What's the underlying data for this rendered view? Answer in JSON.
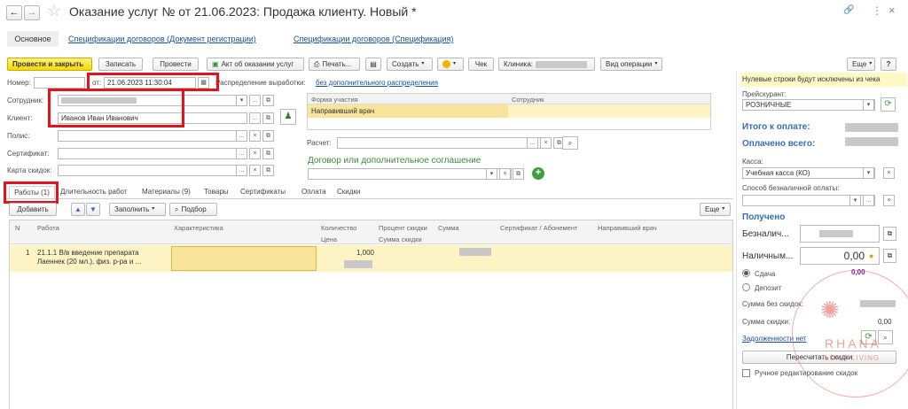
{
  "window": {
    "title": "Оказание услуг №  от 21.06.2023: Продажа клиенту. Новый *",
    "nav_back": "←",
    "nav_forward": "→",
    "star": "☆",
    "link_icon": "🔗",
    "menu_icon": "⋮",
    "close_icon": "×"
  },
  "view_tabs": {
    "main": "Основное",
    "spec_doc": "Спецификации договоров (Документ регистрации)",
    "spec": "Спецификации договоров (Спецификация)"
  },
  "toolbar": {
    "post_close": "Провести и закрыть",
    "save": "Записать",
    "post": "Провести",
    "act": "Акт об оказании услуг",
    "print": "Печать...",
    "create": "Создать",
    "check": "Чек",
    "clinic": "Клиника:",
    "op_type": "Вид операции",
    "more": "Еще",
    "help": "?"
  },
  "form": {
    "number_label": "Номер:",
    "number_value": "",
    "date_prefix": "от:",
    "date_value": "21.06.2023 11:30:04",
    "distribution_label": "Распределение выработки:",
    "distribution_link": "без дополнительного распределения",
    "employee_label": "Сотрудник:",
    "client_label": "Клиент:",
    "client_value": "Иванов Иван Иванович",
    "policy_label": "Полис:",
    "certificate_label": "Сертификат:",
    "discount_card_label": "Карта скидок:",
    "payment_label": "Расчет:",
    "contract_label": "Договор или дополнительное соглашение"
  },
  "participation": {
    "headers": [
      "Форма участия",
      "Сотрудник"
    ],
    "rows": [
      [
        "Направивший врач",
        ""
      ]
    ]
  },
  "doc_tabs": [
    "Работы (1)",
    "Длительность работ",
    "Материалы (9)",
    "Товары",
    "Сертификаты",
    "Оплата",
    "Скидки"
  ],
  "grid_toolbar": {
    "add": "Добавить",
    "fill": "Заполнить",
    "select": "Подбор",
    "more": "Еще"
  },
  "grid": {
    "headers": {
      "n": "N",
      "work": "Работа",
      "characteristic": "Характеристика",
      "quantity": "Количество",
      "price": "Цена",
      "discount_pct": "Процент скидки",
      "discount_sum": "Сумма скидки",
      "sum": "Сумма",
      "certificate": "Сертификат / Абонемент",
      "referring_doctor": "Направивший врач"
    },
    "rows": [
      {
        "n": "1",
        "work_line1": "21.1.1 В/в введение препарата",
        "work_line2": "Лаеннек (20 мл.), физ. р-ра  и ...",
        "quantity": "1,000"
      }
    ]
  },
  "right_panel": {
    "notice": "Нулевые строки будут исключены из чека",
    "price_list_label": "Прейскурант:",
    "price_list_value": "РОЗНИЧНЫЕ",
    "total_label": "Итого к оплате:",
    "paid_label": "Оплачено всего:",
    "cash_register_label": "Касса:",
    "cash_register_value": "Учебная касса (КО)",
    "cashless_method_label": "Способ безналичной оплаты:",
    "received_title": "Получено",
    "cashless_label": "Безналич...",
    "cash_label": "Наличным...",
    "cash_value": "0,00",
    "change_label": "Сдача",
    "change_value": "0,00",
    "deposit_label": "Депозит",
    "sum_wo_discount_label": "Сумма без скидок:",
    "discount_sum_label": "Сумма скидки:",
    "discount_sum_value": "0,00",
    "debts_link": "Задолженности нет",
    "recalc_button": "Пересчитать скидки",
    "manual_discount_label": "Ручное редактирование скидок"
  },
  "watermark": {
    "name": "RHANA",
    "slogan": "LONG LIVING"
  },
  "colors": {
    "accent_yellow": "#f6d800",
    "selected_row": "#fdf3c5",
    "link_blue": "#1a4fa0",
    "highlight_red": "#e3121d",
    "value_purple": "#7a1fa2"
  }
}
